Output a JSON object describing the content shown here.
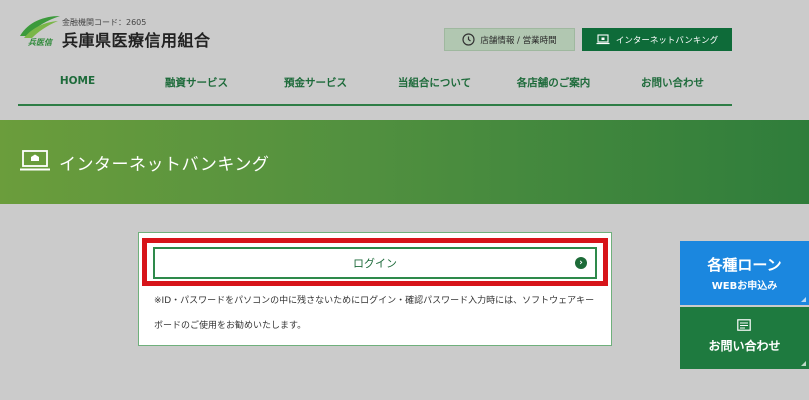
{
  "header": {
    "bank_code": "金融機関コード：2605",
    "bank_name": "兵庫県医療信用組合",
    "logo_text": "兵医信",
    "hours_button": "店舗情報 / 営業時間",
    "ib_button": "インターネットバンキング"
  },
  "nav": {
    "items": [
      {
        "label": "HOME"
      },
      {
        "label": "融資サービス"
      },
      {
        "label": "預金サービス"
      },
      {
        "label": "当組合について"
      },
      {
        "label": "各店舗のご案内"
      },
      {
        "label": "お問い合わせ"
      }
    ]
  },
  "banner": {
    "title": "インターネットバンキング"
  },
  "login": {
    "button_label": "ログイン",
    "note": "※ID・パスワードをパソコンの中に残さないためにログイン・確認パスワード入力時には、ソフトウェアキーボードのご使用をお勧めいたします。"
  },
  "side": {
    "loan_title": "各種ローン",
    "loan_sub": "WEBお申込み",
    "contact_label": "お問い合わせ"
  },
  "colors": {
    "brand_green": "#0e6b39",
    "highlight_red": "#d7141a",
    "loan_blue": "#1b87df"
  }
}
